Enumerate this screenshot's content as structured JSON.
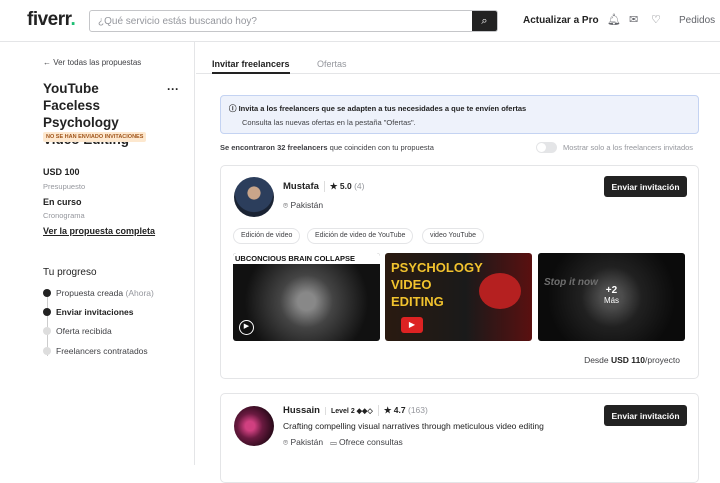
{
  "header": {
    "logo": "fiverr",
    "search_placeholder": "¿Qué servicio estás buscando hoy?",
    "upgrade": "Actualizar a Pro",
    "orders": "Pedidos"
  },
  "sidebar": {
    "back": "← Ver todas las propuestas",
    "title": "YouTube Faceless Psychology Video Editing",
    "badge": "NO SE HAN ENVIADO INVITACIONES",
    "budget_value": "USD 100",
    "budget_label": "Presupuesto",
    "timeline_value": "En curso",
    "timeline_label": "Cronograma",
    "view_link": "Ver la propuesta completa",
    "progress_title": "Tu progreso",
    "steps": [
      {
        "label": "Propuesta creada",
        "note": "(Ahora)"
      },
      {
        "label": "Enviar invitaciones"
      },
      {
        "label": "Oferta recibida"
      },
      {
        "label": "Freelancers contratados"
      }
    ]
  },
  "tabs": [
    "Invitar freelancers",
    "Ofertas"
  ],
  "info": {
    "title": "Invita a los freelancers que se adapten a tus necesidades a que te envíen ofertas",
    "text": "Consulta las nuevas ofertas en la pestaña \"Ofertas\"."
  },
  "results": {
    "bold": "Se encontraron 32 freelancers",
    "rest": " que coinciden con tu propuesta",
    "toggle_label": "Mostrar solo a los freelancers invitados"
  },
  "freelancers": [
    {
      "name": "Mustafa",
      "rating": "5.0",
      "reviews": "(4)",
      "location": "Pakistán",
      "button": "Enviar invitación",
      "tags": [
        "Edición de video",
        "Edición de video de YouTube",
        "video YouTube"
      ],
      "thumbs": [
        "UBCONCIOUS BRAIN COLLAPSE",
        "PSYCHOLOGY VIDEO EDITING",
        "Stop it now"
      ],
      "more": "+2",
      "more_label": "Más",
      "price_prefix": "Desde ",
      "price": "USD 110",
      "price_suffix": "/proyecto"
    },
    {
      "name": "Hussain",
      "level": "Level 2 ◆◆◇",
      "rating": "4.7",
      "reviews": "(163)",
      "tagline": "Crafting compelling visual narratives through meticulous video editing",
      "location": "Pakistán",
      "consult": "Ofrece consultas",
      "button": "Enviar invitación"
    }
  ]
}
